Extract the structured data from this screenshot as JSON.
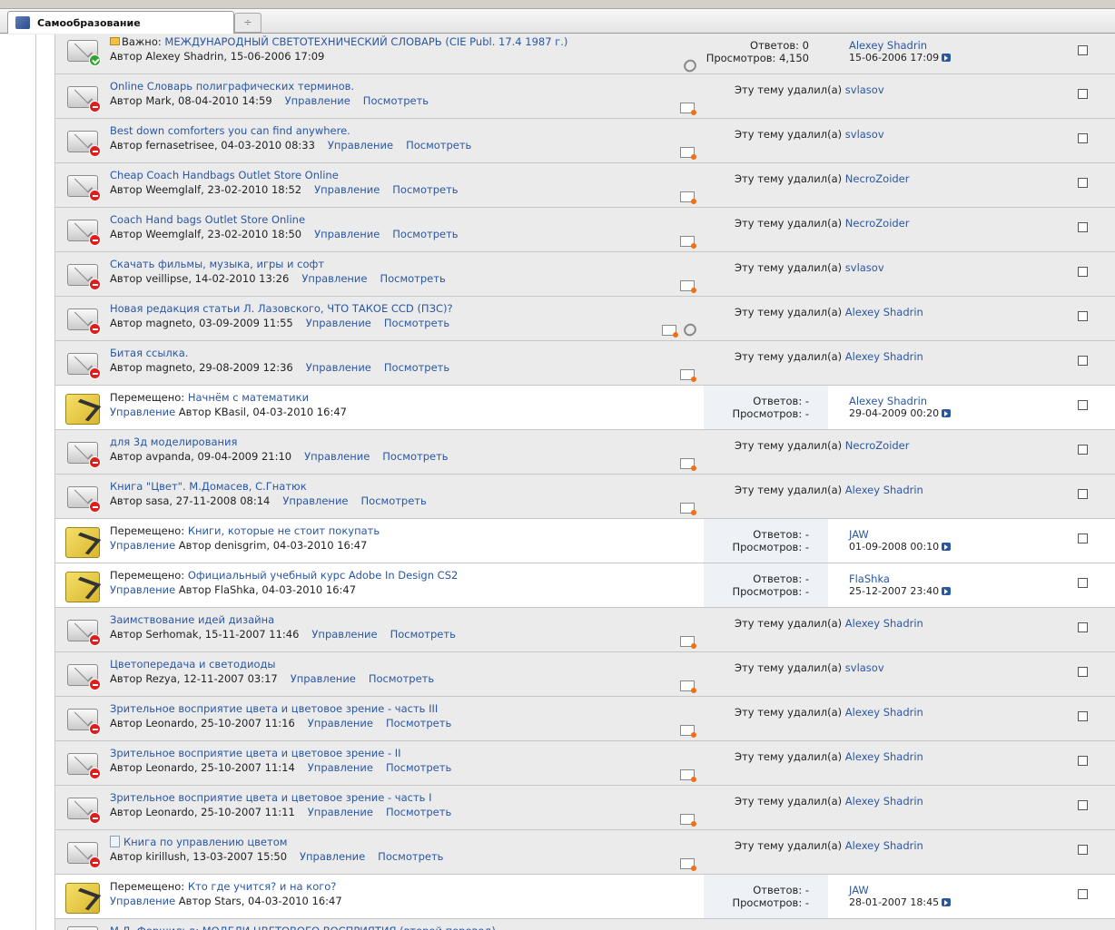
{
  "tab": {
    "title": "Самообразование",
    "new_tab": "÷"
  },
  "labels": {
    "author_prefix": "Автор",
    "moved_prefix": "Перемещено:",
    "important_prefix": "Важно:",
    "manage": "Управление",
    "view": "Посмотреть",
    "deleted_by": "Эту тему удалил(а)",
    "replies": "Ответов:",
    "views": "Просмотров:"
  },
  "threads": [
    {
      "kind": "important",
      "title": "МЕЖДУНАРОДНЫЙ СВЕТОТЕХНИЧЕСКИЙ СЛОВАРЬ (CIE Publ. 17.4 1987 г.)",
      "meta": "Автор Alexey Shadrin, 15-06-2006 17:09",
      "replies": "Ответов: 0",
      "views": "Просмотров: 4,150",
      "last_user": "Alexey Shadrin",
      "last_date": "15-06-2006 17:09"
    },
    {
      "kind": "deleted",
      "title": "Online Словарь полиграфических терминов.",
      "meta": "Автор Mark, 08-04-2010 14:59",
      "deleter": "svlasov"
    },
    {
      "kind": "deleted",
      "title": "Best down comforters you can find anywhere.",
      "meta": "Автор fernasetrisee, 04-03-2010 08:33",
      "deleter": "svlasov"
    },
    {
      "kind": "deleted",
      "title": "Cheap Coach Handbags Outlet Store Online",
      "meta": "Автор Weemglalf, 23-02-2010 18:52",
      "deleter": "NecroZoider"
    },
    {
      "kind": "deleted",
      "title": "Coach Hand bags Outlet Store Online",
      "meta": "Автор Weemglalf, 23-02-2010 18:50",
      "deleter": "NecroZoider"
    },
    {
      "kind": "deleted",
      "title": "Скачать фильмы, музыка, игры и софт",
      "meta": "Автор veillipse, 14-02-2010 13:26",
      "deleter": "svlasov"
    },
    {
      "kind": "deleted",
      "title": "Новая редакция статьи Л. Лазовского, ЧТО ТАКОЕ CCD (ПЗС)?",
      "meta": "Автор magneto, 03-09-2009 11:55",
      "deleter": "Alexey Shadrin",
      "clip": true
    },
    {
      "kind": "deleted",
      "title": "Битая ссылка.",
      "meta": "Автор magneto, 29-08-2009 12:36",
      "deleter": "Alexey Shadrin"
    },
    {
      "kind": "moved",
      "title": "Начнём с математики",
      "meta": "Автор KBasil, 04-03-2010 16:47",
      "replies": "Ответов: -",
      "views": "Просмотров: -",
      "last_user": "Alexey Shadrin",
      "last_date": "29-04-2009 00:20"
    },
    {
      "kind": "deleted",
      "title": "для 3д моделирования",
      "meta": "Автор avpanda, 09-04-2009 21:10",
      "deleter": "NecroZoider"
    },
    {
      "kind": "deleted",
      "title": "Книга \"Цвет\". М.Домасев, С.Гнатюк",
      "meta": "Автор sasa, 27-11-2008 08:14",
      "deleter": "Alexey Shadrin"
    },
    {
      "kind": "moved",
      "title": "Книги, которые не стоит покупать",
      "meta": "Автор denisgrim, 04-03-2010 16:47",
      "replies": "Ответов: -",
      "views": "Просмотров: -",
      "last_user": "JAW",
      "last_date": "01-09-2008 00:10"
    },
    {
      "kind": "moved",
      "title": "Официальный учебный курс Adobe In Design CS2",
      "meta": "Автор FlaShka, 04-03-2010 16:47",
      "replies": "Ответов: -",
      "views": "Просмотров: -",
      "last_user": "FlaShka",
      "last_date": "25-12-2007 23:40"
    },
    {
      "kind": "deleted",
      "title": "Заимствование идей дизайна",
      "meta": "Автор Serhomak, 15-11-2007 11:46",
      "deleter": "Alexey Shadrin"
    },
    {
      "kind": "deleted",
      "title": "Цветопередача и светодиоды",
      "meta": "Автор Rezya, 12-11-2007 03:17",
      "deleter": "svlasov"
    },
    {
      "kind": "deleted",
      "title": "Зрительное восприятие цвета и цветовое зрение - часть III",
      "meta": "Автор Leonardo, 25-10-2007 11:16",
      "deleter": "Alexey Shadrin"
    },
    {
      "kind": "deleted",
      "title": "Зрительное восприятие цвета и цветовое зрение - II",
      "meta": "Автор Leonardo, 25-10-2007 11:14",
      "deleter": "Alexey Shadrin"
    },
    {
      "kind": "deleted",
      "title": "Зрительное восприятие цвета и цветовое зрение - часть I",
      "meta": "Автор Leonardo, 25-10-2007 11:11",
      "deleter": "Alexey Shadrin"
    },
    {
      "kind": "deleted",
      "title": "Книга по управлению цветом",
      "meta": "Автор kirillush, 13-03-2007 15:50",
      "deleter": "Alexey Shadrin",
      "doc": true
    },
    {
      "kind": "moved",
      "title": "Кто где учится? и на кого?",
      "meta": "Автор Stars, 04-03-2010 16:47",
      "replies": "Ответов: -",
      "views": "Просмотров: -",
      "last_user": "JAW",
      "last_date": "28-01-2007 18:45"
    },
    {
      "kind": "partial",
      "title": "М.Д. Фершильд: МОДЕЛИ ЦВЕТОВОГО ВОСПРИЯТИЯ (второй перевод)"
    }
  ]
}
